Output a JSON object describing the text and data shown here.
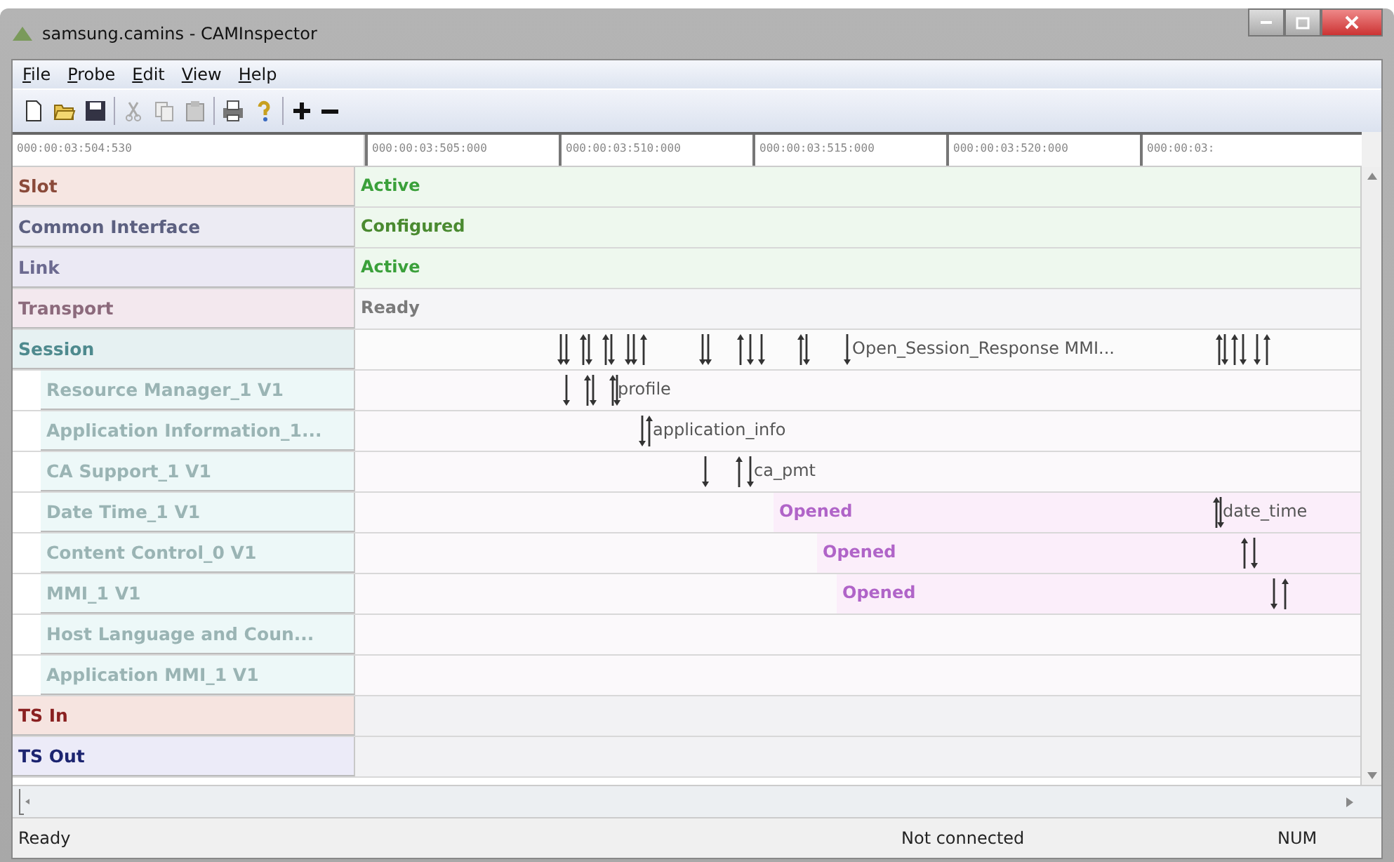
{
  "window": {
    "title": "samsung.camins - CAMInspector"
  },
  "menu": [
    "File",
    "Probe",
    "Edit",
    "View",
    "Help"
  ],
  "ruler": [
    "000:00:03:504:530",
    "000:00:03:505:000",
    "000:00:03:510:000",
    "000:00:03:515:000",
    "000:00:03:520:000",
    "000:00:03:"
  ],
  "rows": [
    {
      "label": "Slot",
      "kind": "slot",
      "state": {
        "text": "Active",
        "kind": "active"
      }
    },
    {
      "label": "Common Interface",
      "kind": "interface",
      "state": {
        "text": "Configured",
        "kind": "configured"
      }
    },
    {
      "label": "Link",
      "kind": "link",
      "state": {
        "text": "Active",
        "kind": "active"
      }
    },
    {
      "label": "Transport",
      "kind": "transport",
      "state": {
        "text": "Ready",
        "kind": "ready"
      }
    },
    {
      "label": "Session",
      "kind": "session",
      "events": [
        {
          "kind": "down"
        },
        {
          "kind": "down"
        },
        {
          "kind": "up"
        },
        {
          "kind": "down"
        },
        {
          "kind": "up"
        },
        {
          "kind": "down"
        },
        {
          "kind": "down"
        },
        {
          "kind": "down"
        },
        {
          "kind": "up"
        },
        {
          "kind": "down"
        },
        {
          "kind": "down"
        },
        {
          "kind": "up"
        },
        {
          "kind": "down"
        },
        {
          "kind": "down"
        },
        {
          "kind": "up"
        },
        {
          "kind": "down"
        },
        {
          "kind": "down"
        },
        {
          "kind": "up"
        },
        {
          "kind": "down"
        },
        {
          "kind": "up"
        },
        {
          "kind": "down"
        },
        {
          "kind": "down"
        },
        {
          "kind": "up"
        }
      ],
      "messages": [
        "Open_Session_Response MMI..."
      ],
      "children": [
        {
          "label": "Resource Manager_1 V1",
          "kind": "resource",
          "events": [
            {
              "kind": "down"
            },
            {
              "kind": "up"
            },
            {
              "kind": "down"
            },
            {
              "kind": "up"
            },
            {
              "kind": "down"
            }
          ],
          "messages": [
            "profile"
          ]
        },
        {
          "label": "Application Information_1...",
          "kind": "resource",
          "events": [
            {
              "kind": "down"
            },
            {
              "kind": "up"
            }
          ],
          "messages": [
            "application_info"
          ]
        },
        {
          "label": "CA Support_1 V1",
          "kind": "resource",
          "events": [
            {
              "kind": "down"
            },
            {
              "kind": "up"
            },
            {
              "kind": "down"
            }
          ],
          "messages": [
            "ca_pmt"
          ]
        },
        {
          "label": "Date Time_1 V1",
          "kind": "resource",
          "state": {
            "text": "Opened",
            "kind": "opened"
          },
          "events": [
            {
              "kind": "up"
            },
            {
              "kind": "down"
            }
          ],
          "messages": [
            "date_time"
          ]
        },
        {
          "label": "Content Control_0 V1",
          "kind": "resource",
          "state": {
            "text": "Opened",
            "kind": "opened"
          },
          "events": [
            {
              "kind": "up"
            },
            {
              "kind": "down"
            }
          ]
        },
        {
          "label": "MMI_1 V1",
          "kind": "resource",
          "state": {
            "text": "Opened",
            "kind": "opened"
          },
          "events": [
            {
              "kind": "down"
            },
            {
              "kind": "up"
            }
          ]
        },
        {
          "label": "Host Language and Coun...",
          "kind": "resource"
        },
        {
          "label": "Application MMI_1 V1",
          "kind": "resource"
        }
      ]
    },
    {
      "label": "TS In",
      "kind": "ts_in"
    },
    {
      "label": "TS Out",
      "kind": "ts_out"
    }
  ],
  "status_bar": [
    "Ready",
    "Not connected",
    "NUM"
  ]
}
